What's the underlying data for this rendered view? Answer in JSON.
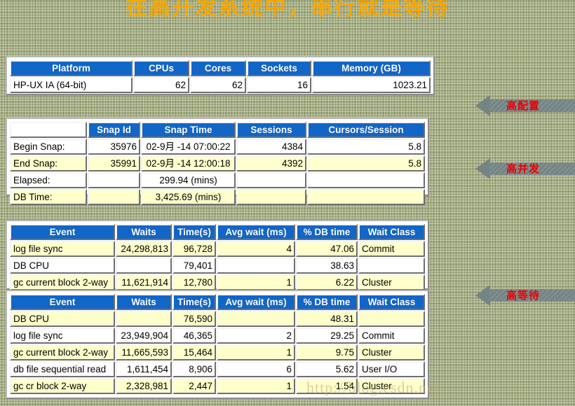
{
  "title": "在高开发系统中，串行就是等待",
  "watermark": "http://blog.csdn.net",
  "platform_table": {
    "headers": [
      "Platform",
      "CPUs",
      "Cores",
      "Sockets",
      "Memory (GB)"
    ],
    "rows": [
      [
        "HP-UX IA (64-bit)",
        "62",
        "62",
        "16",
        "1023.21"
      ]
    ]
  },
  "snapshot_table": {
    "headers": [
      "",
      "Snap Id",
      "Snap Time",
      "Sessions",
      "Cursors/Session"
    ],
    "rows": [
      [
        "Begin Snap:",
        "35976",
        "02-9月 -14 07:00:22",
        "4384",
        "5.8"
      ],
      [
        "End Snap:",
        "35991",
        "02-9月 -14 12:00:18",
        "4392",
        "5.8"
      ],
      [
        "Elapsed:",
        "",
        "299.94 (mins)",
        "",
        ""
      ],
      [
        "DB Time:",
        "",
        "3,425.69 (mins)",
        "",
        ""
      ]
    ]
  },
  "events_table_top": {
    "headers": [
      "Event",
      "Waits",
      "Time(s)",
      "Avg wait (ms)",
      "% DB time",
      "Wait Class"
    ],
    "rows": [
      [
        "log file sync",
        "24,298,813",
        "96,728",
        "4",
        "47.06",
        "Commit"
      ],
      [
        "DB CPU",
        "",
        "79,401",
        "",
        "38.63",
        ""
      ],
      [
        "gc current block 2-way",
        "11,621,914",
        "12,780",
        "1",
        "6.22",
        "Cluster"
      ]
    ]
  },
  "events_table_bottom": {
    "headers": [
      "Event",
      "Waits",
      "Time(s)",
      "Avg wait (ms)",
      "% DB time",
      "Wait Class"
    ],
    "rows": [
      [
        "DB CPU",
        "",
        "76,590",
        "",
        "48.31",
        ""
      ],
      [
        "log file sync",
        "23,949,904",
        "46,365",
        "2",
        "29.25",
        "Commit"
      ],
      [
        "gc current block 2-way",
        "11,665,593",
        "15,464",
        "1",
        "9.75",
        "Cluster"
      ],
      [
        "db file sequential read",
        "1,611,454",
        "8,906",
        "6",
        "5.62",
        "User I/O"
      ],
      [
        "gc cr block 2-way",
        "2,328,981",
        "2,447",
        "1",
        "1.54",
        "Cluster"
      ]
    ]
  },
  "annotations": [
    {
      "label": "高配置"
    },
    {
      "label": "高并发"
    },
    {
      "label": "高等待"
    }
  ],
  "colors": {
    "background": "#a9b287",
    "title": "#f7a600",
    "header_blue": "#1166c8",
    "row_cream": "#ffffcc",
    "row_white": "#ffffff",
    "arrow_gray": "#748484",
    "annotation_red": "#ee0000"
  }
}
